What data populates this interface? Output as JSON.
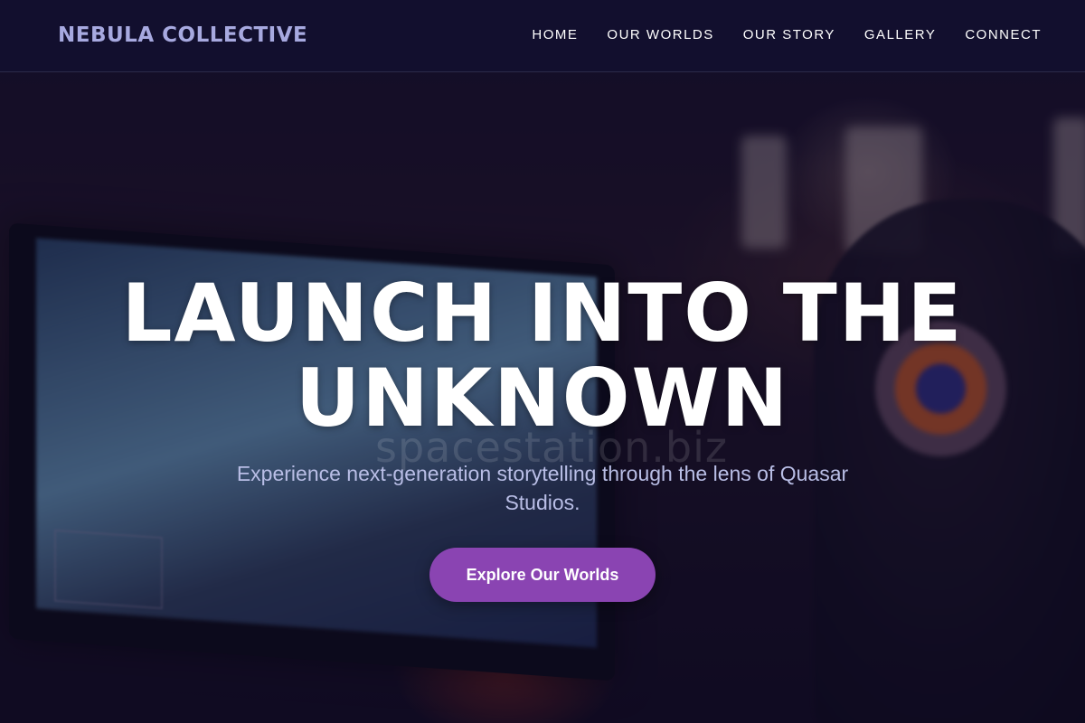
{
  "brand": {
    "logo_text": "NEBULA COLLECTIVE"
  },
  "nav": {
    "items": [
      {
        "label": "HOME"
      },
      {
        "label": "OUR WORLDS"
      },
      {
        "label": "OUR STORY"
      },
      {
        "label": "GALLERY"
      },
      {
        "label": "CONNECT"
      }
    ]
  },
  "hero": {
    "title": "LAUNCH INTO THE UNKNOWN",
    "subtitle": "Experience next-generation storytelling through the lens of Quasar Studios.",
    "cta_label": "Explore Our Worlds",
    "watermark": "spacestation.biz"
  },
  "colors": {
    "header_bg": "#120f2e",
    "brand_text": "#a7a9e0",
    "cta_bg": "#8a44b2",
    "subtitle_text": "#b9bee6"
  }
}
